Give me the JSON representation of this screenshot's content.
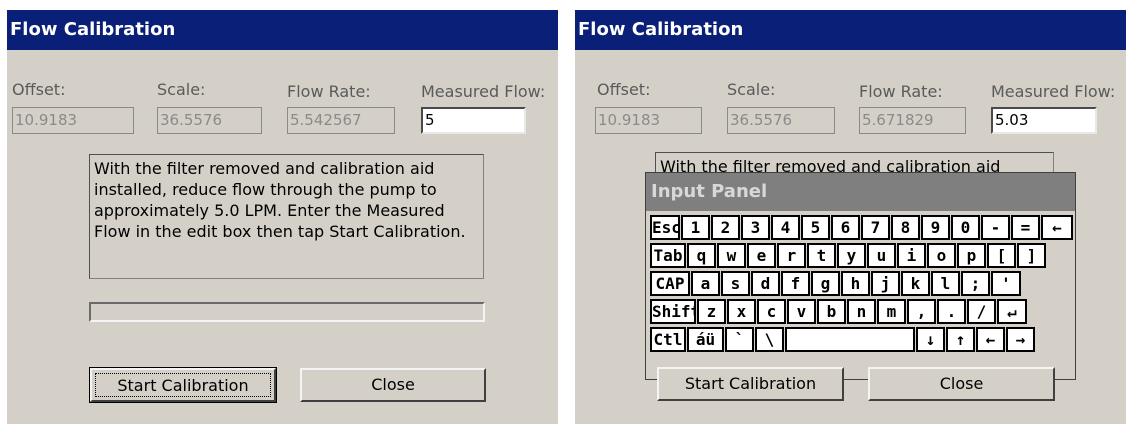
{
  "left": {
    "title": "Flow Calibration",
    "offset_label": "Offset:",
    "scale_label": "Scale:",
    "flow_rate_label": "Flow Rate:",
    "measured_flow_label": "Measured Flow:",
    "offset_value": "10.9183",
    "scale_value": "36.5576",
    "flow_rate_value": "5.542567",
    "measured_flow_value": "5",
    "instructions": "With the filter removed and calibration aid installed, reduce flow through the pump to approximately  5.0 LPM.  Enter the Measured Flow in the edit box then tap Start Calibration.",
    "start_button": "Start Calibration",
    "close_button": "Close"
  },
  "right": {
    "title": "Flow Calibration",
    "offset_label": "Offset:",
    "scale_label": "Scale:",
    "flow_rate_label": "Flow Rate:",
    "measured_flow_label": "Measured Flow:",
    "offset_value": "10.9183",
    "scale_value": "36.5576",
    "flow_rate_value": "5.671829",
    "measured_flow_value": "5.03",
    "instructions": "With the filter removed and calibration aid",
    "start_button": "Start Calibration",
    "close_button": "Close",
    "input_panel_title": "Input Panel",
    "keyboard_rows": [
      [
        "Esc",
        "1",
        "2",
        "3",
        "4",
        "5",
        "6",
        "7",
        "8",
        "9",
        "0",
        "-",
        "=",
        "←"
      ],
      [
        "Tab",
        "q",
        "w",
        "e",
        "r",
        "t",
        "y",
        "u",
        "i",
        "o",
        "p",
        "[",
        "]"
      ],
      [
        "CAP",
        "a",
        "s",
        "d",
        "f",
        "g",
        "h",
        "j",
        "k",
        "l",
        ";",
        "'"
      ],
      [
        "Shift",
        "z",
        "x",
        "c",
        "v",
        "b",
        "n",
        "m",
        ",",
        ".",
        "/",
        "↵"
      ],
      [
        "Ctl",
        "áü",
        "`",
        "\\",
        "",
        "↓",
        "↑",
        "←",
        "→"
      ]
    ]
  }
}
